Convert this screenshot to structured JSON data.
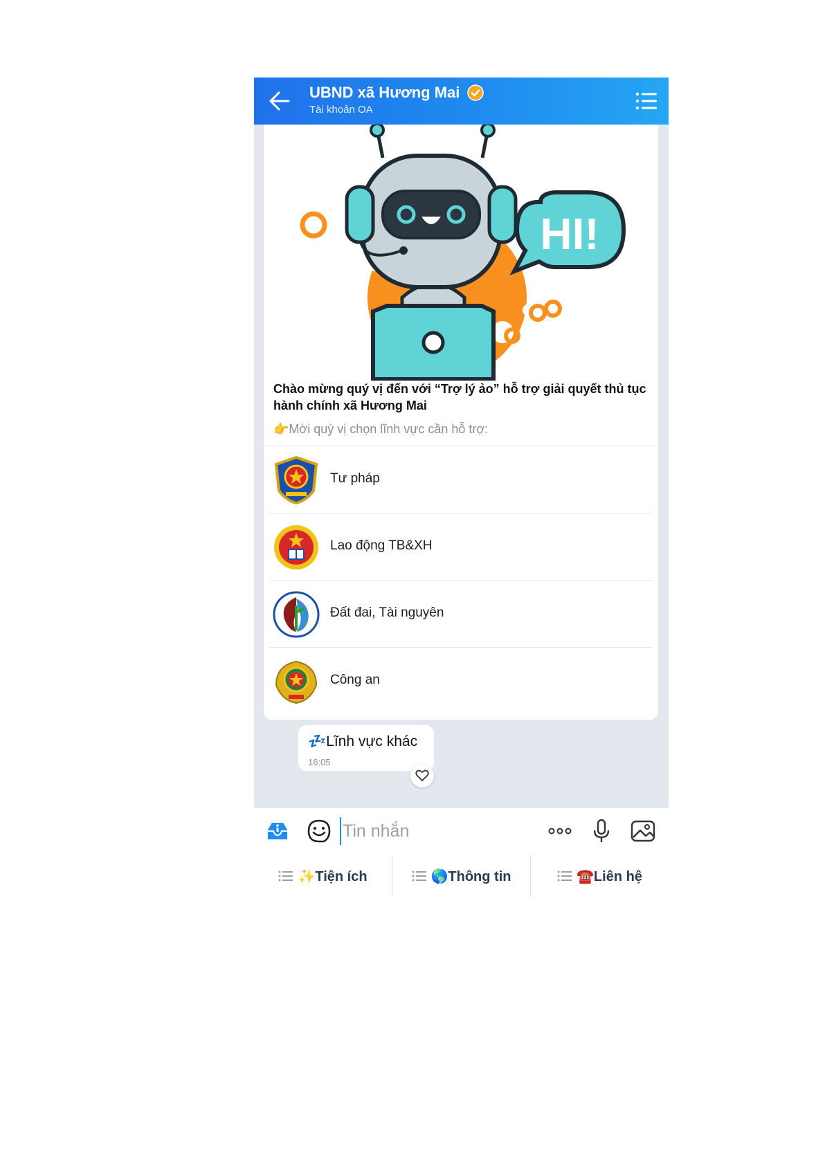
{
  "header": {
    "title": "UBND xã Hương Mai",
    "subtitle": "Tài khoản OA"
  },
  "card": {
    "hero_text": "HI!",
    "welcome": "Chào mừng quý vị đến với “Trợ lý ảo” hỗ trợ giải quyết thủ tục hành chính xã Hương Mai",
    "prompt": "👉Mời quý vị chọn lĩnh vực cần hỗ trợ:",
    "options": [
      {
        "label": "Tư pháp"
      },
      {
        "label": "Lao động TB&XH"
      },
      {
        "label": "Đất đai, Tài nguyên"
      },
      {
        "label": "Công an"
      }
    ]
  },
  "message": {
    "text": "💤Lĩnh vực khác",
    "time": "16:05"
  },
  "input": {
    "placeholder": "Tin nhắn"
  },
  "quick_bar": [
    {
      "label": "✨Tiện ích"
    },
    {
      "label": "🌎Thông tin"
    },
    {
      "label": "☎️Liên hệ"
    }
  ],
  "colors": {
    "header_start": "#1f72ea",
    "header_end": "#25a6f3",
    "chat_background": "#e3e8ef",
    "verified_badge": "#f5a623"
  }
}
